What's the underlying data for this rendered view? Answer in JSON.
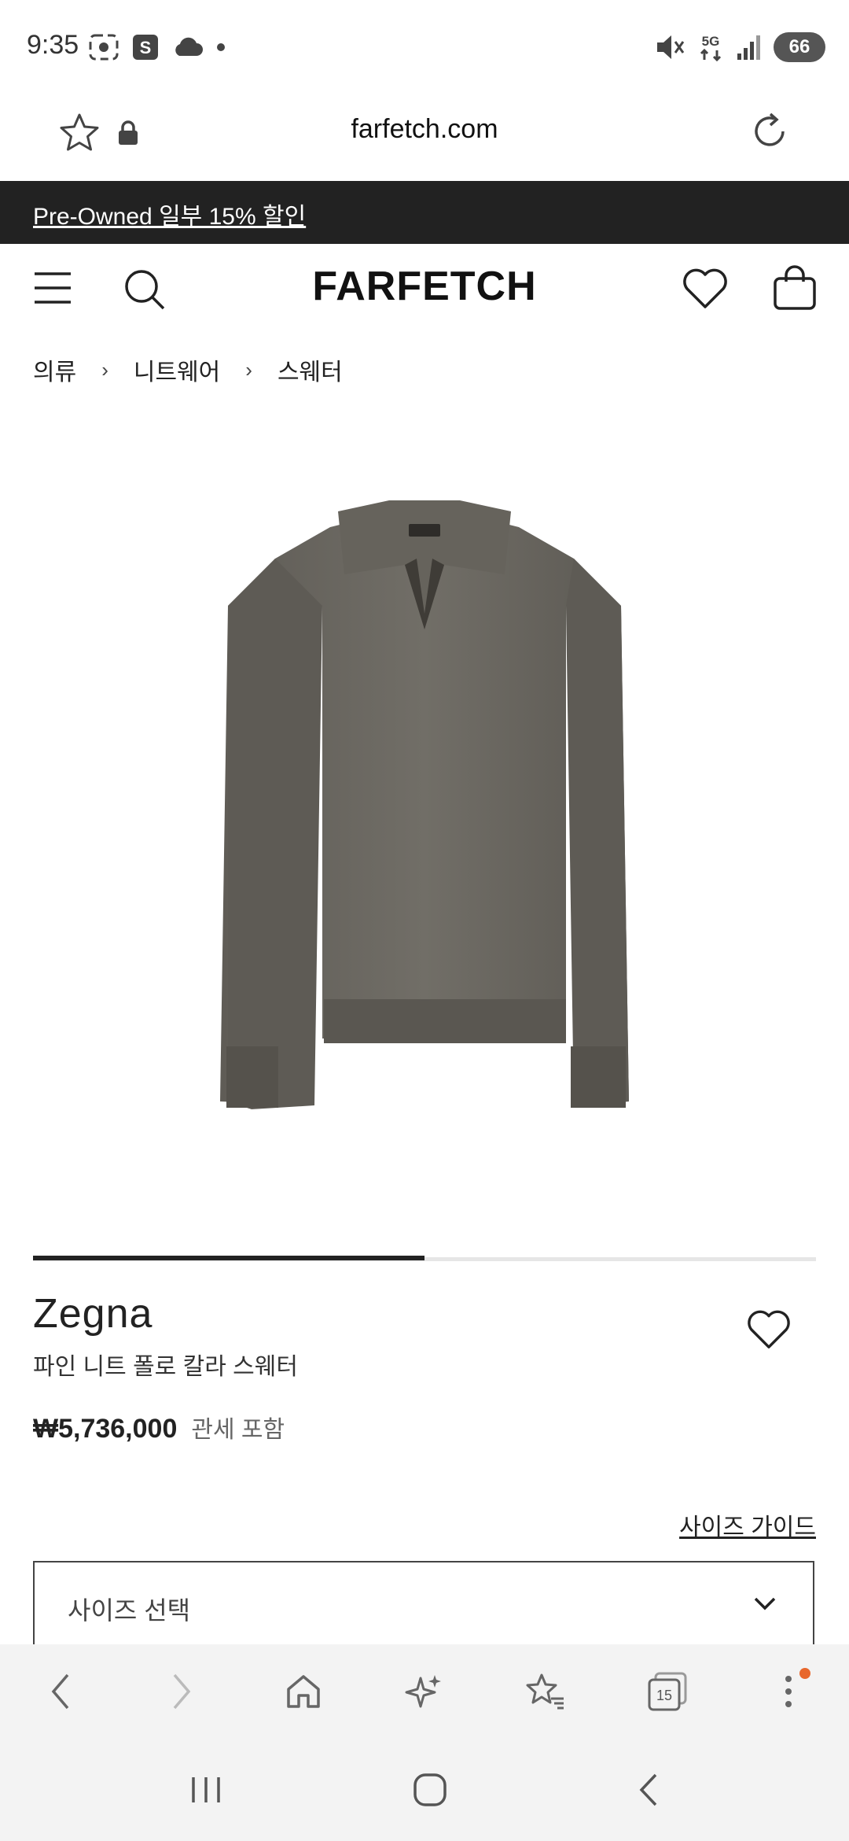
{
  "status_bar": {
    "time": "9:35",
    "network": "5G",
    "battery": "66"
  },
  "browser": {
    "url": "farfetch.com",
    "tab_count": "15"
  },
  "promo": {
    "text": "Pre-Owned 일부 15% 할인"
  },
  "header": {
    "logo": "FARFETCH"
  },
  "breadcrumb": [
    "의류",
    "니트웨어",
    "스웨터"
  ],
  "breadcrumb_separator": "›",
  "carousel": {
    "progress": 0.5
  },
  "product": {
    "brand": "Zegna",
    "name": "파인 니트 폴로 칼라 스웨터",
    "price": "₩5,736,000",
    "duty_note": "관세 포함",
    "color": "#6e6b64"
  },
  "size": {
    "guide_label": "사이즈 가이드",
    "select_placeholder": "사이즈 선택"
  },
  "icons": {
    "left_status": [
      "screenshot-icon",
      "s-app-icon",
      "cloud-icon",
      "dot-icon"
    ],
    "right_status": [
      "mute-icon",
      "5g-icon",
      "signal-icon",
      "battery-icon"
    ]
  }
}
